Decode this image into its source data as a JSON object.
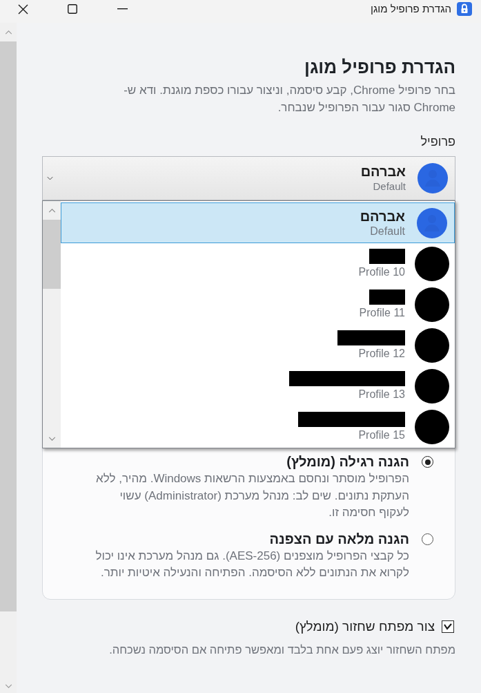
{
  "window": {
    "title": "הגדרת פרופיל מוגן"
  },
  "heading": "הגדרת פרופיל מוגן",
  "description": "בחר פרופיל Chrome, קבע סיסמה, וניצור עבורו כספת מוגנת. ודא ש-Chrome סגור עבור הפרופיל שנבחר.",
  "profile_select": {
    "label": "פרופיל",
    "expanded": true,
    "value": {
      "name": "אברהם",
      "subtitle": "Default"
    },
    "options": [
      {
        "name": "אברהם",
        "subtitle": "Default",
        "redacted": false,
        "selected": true
      },
      {
        "subtitle": "Profile 10",
        "redacted": true,
        "selected": false
      },
      {
        "subtitle": "Profile 11",
        "redacted": true,
        "selected": false
      },
      {
        "subtitle": "Profile 12",
        "redacted": true,
        "selected": false
      },
      {
        "subtitle": "Profile 13",
        "redacted": true,
        "selected": false
      },
      {
        "subtitle": "Profile 15",
        "redacted": true,
        "selected": false
      }
    ]
  },
  "protection_options": [
    {
      "title": "הגנה רגילה (מומלץ)",
      "description": "הפרופיל מוסתר ונחסם באמצעות הרשאות Windows. מהיר, ללא העתקת נתונים. שים לב: מנהל מערכת (Administrator) עשוי לעקוף חסימה זו.",
      "selected": true
    },
    {
      "title": "הגנה מלאה עם הצפנה",
      "description": "כל קבצי הפרופיל מוצפנים (AES-256). גם מנהל מערכת אינו יכול לקרוא את הנתונים ללא הסיסמה. הפתיחה והנעילה איטיות יותר.",
      "selected": false
    }
  ],
  "recovery_key": {
    "label": "צור מפתח שחזור (מומלץ)",
    "checked": true,
    "description": "מפתח השחזור יוצג פעם אחת בלבד ומאפשר פתיחה אם הסיסמה נשכחה."
  }
}
